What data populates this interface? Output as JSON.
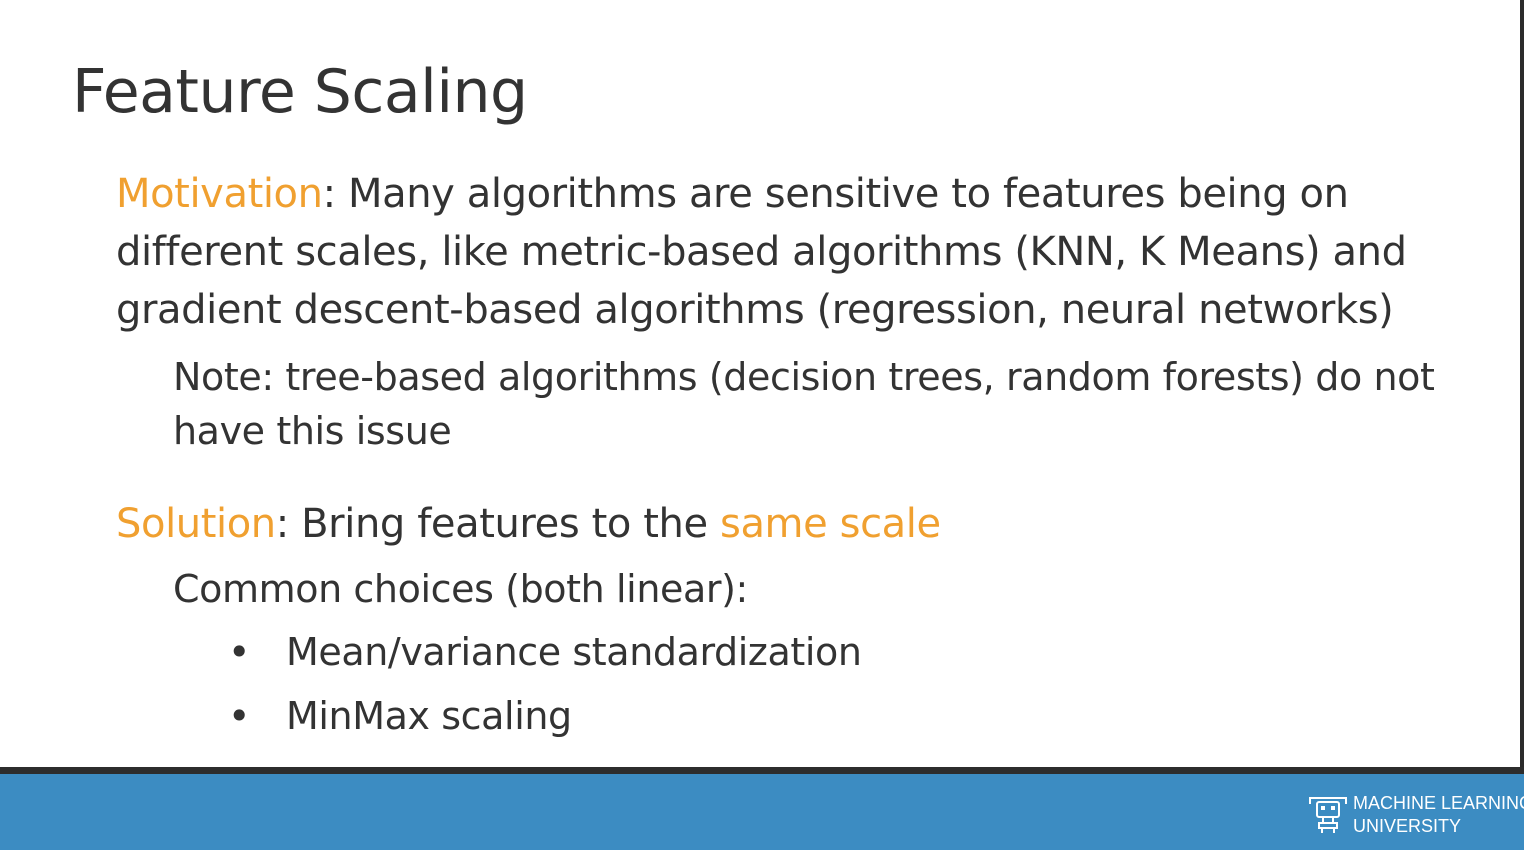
{
  "slide": {
    "title": "Feature Scaling"
  },
  "motivation": {
    "label": "Motivation",
    "text_line1": ": Many algorithms are sensitive to features being on",
    "text_line2": "different scales, like metric-based algorithms (KNN, K Means) and",
    "text_line3": "gradient descent-based algorithms (regression, neural networks)"
  },
  "note": {
    "line1": "Note: tree-based algorithms (decision trees, random forests) do not",
    "line2": "have this issue"
  },
  "solution": {
    "label": "Solution",
    "text": ": Bring features to the ",
    "highlight": "same scale"
  },
  "common_choices": {
    "intro": "Common choices (both linear):",
    "bullet_symbol": "•",
    "items": [
      "Mean/variance standardization",
      "MinMax scaling"
    ]
  },
  "footer": {
    "brand_line1": "MACHINE LEARNING",
    "brand_line2": "UNIVERSITY",
    "logo_icon": "robot-icon",
    "background_color": "#3c8cc2",
    "divider_color": "#2d2d2d"
  },
  "colors": {
    "accent": "#f0a030",
    "text": "#333333"
  }
}
